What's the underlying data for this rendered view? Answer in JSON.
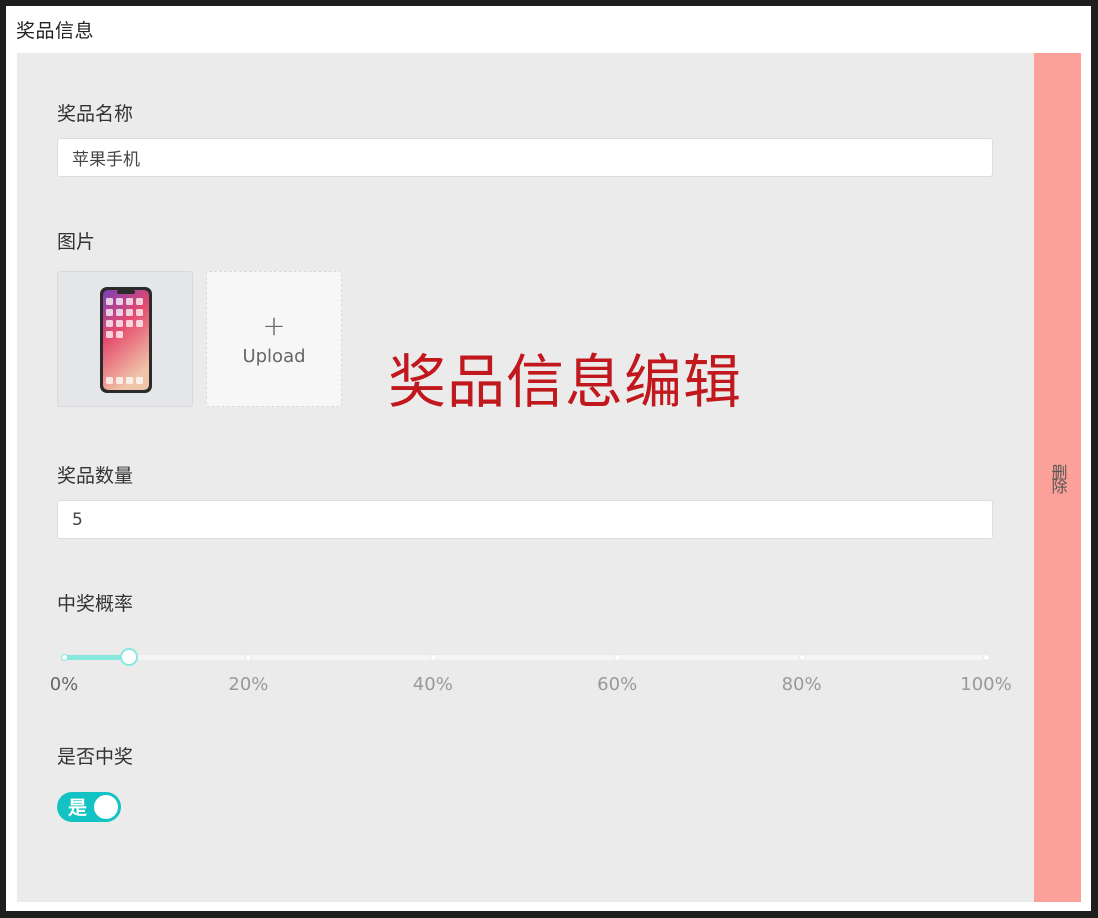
{
  "section": {
    "title": "奖品信息"
  },
  "delete": {
    "label": "删除"
  },
  "form": {
    "name": {
      "label": "奖品名称",
      "value": "苹果手机"
    },
    "image": {
      "label": "图片",
      "upload_plus": "+",
      "upload_text": "Upload",
      "thumbnail_icon": "iphone-icon"
    },
    "quantity": {
      "label": "奖品数量",
      "value": "5"
    },
    "probability": {
      "label": "中奖概率",
      "value_percent": 7,
      "marks": [
        "0%",
        "20%",
        "40%",
        "60%",
        "80%",
        "100%"
      ]
    },
    "win": {
      "label": "是否中奖",
      "switch_text": "是",
      "checked": true
    }
  },
  "annotation": {
    "text": "奖品信息编辑"
  },
  "colors": {
    "accent": "#13c2c2",
    "slider": "#87e8de",
    "delete_bg": "#fca09a",
    "annotation": "#c0181d"
  }
}
